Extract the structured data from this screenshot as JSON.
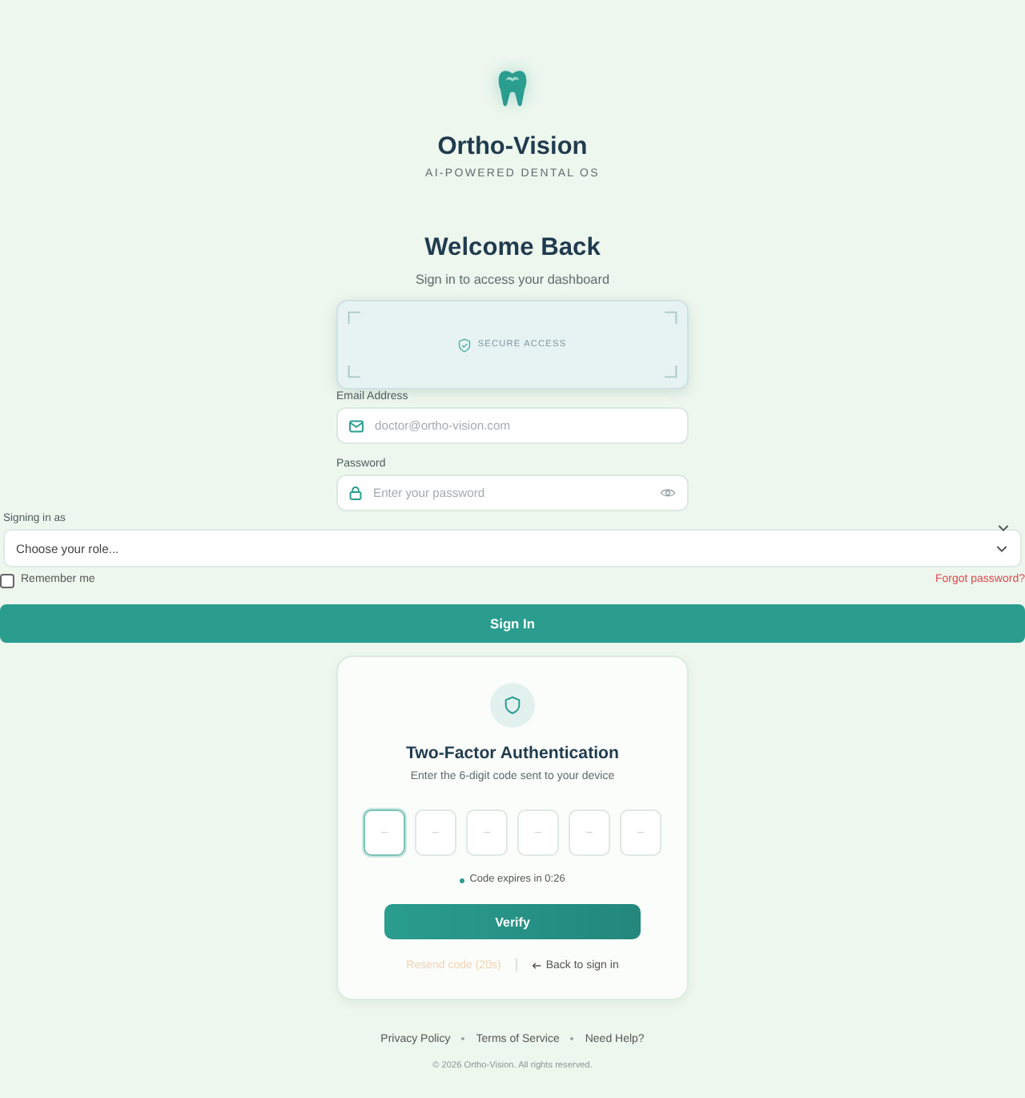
{
  "brand": {
    "name": "Ortho-Vision",
    "tagline": "AI-POWERED DENTAL OS"
  },
  "heading": {
    "title": "Welcome Back",
    "subtitle": "Sign in to access your dashboard"
  },
  "secure_badge": {
    "label": "SECURE ACCESS"
  },
  "form": {
    "fields": [
      {
        "kind": "email",
        "label": "Email Address",
        "placeholder": "doctor@ortho-vision.com"
      },
      {
        "kind": "password",
        "label": "Password",
        "placeholder": "Enter your password"
      }
    ],
    "role": {
      "label": "Signing in as",
      "placeholder": "Choose your role..."
    },
    "remember": {
      "label": "Remember me",
      "checked": false
    },
    "forgot_link": "Forgot password?",
    "submit": "Sign In"
  },
  "two_factor": {
    "title": "Two-Factor Authentication",
    "subtitle": "Enter the 6-digit code sent to your device",
    "code_boxes": [
      {
        "placeholder": "–",
        "focused": true
      },
      {
        "placeholder": "–",
        "focused": false
      },
      {
        "placeholder": "–",
        "focused": false
      },
      {
        "placeholder": "–",
        "focused": false
      },
      {
        "placeholder": "–",
        "focused": false
      },
      {
        "placeholder": "–",
        "focused": false
      }
    ],
    "timer": "Code expires in 0:26",
    "verify": "Verify",
    "resend": {
      "label": "Resend code (20s)",
      "disabled": true
    },
    "back": "Back to sign in"
  },
  "footer": {
    "links": [
      "Privacy Policy",
      "Terms of Service",
      "Need Help?"
    ],
    "copyright": "© 2026 Ortho-Vision. All rights reserved."
  }
}
